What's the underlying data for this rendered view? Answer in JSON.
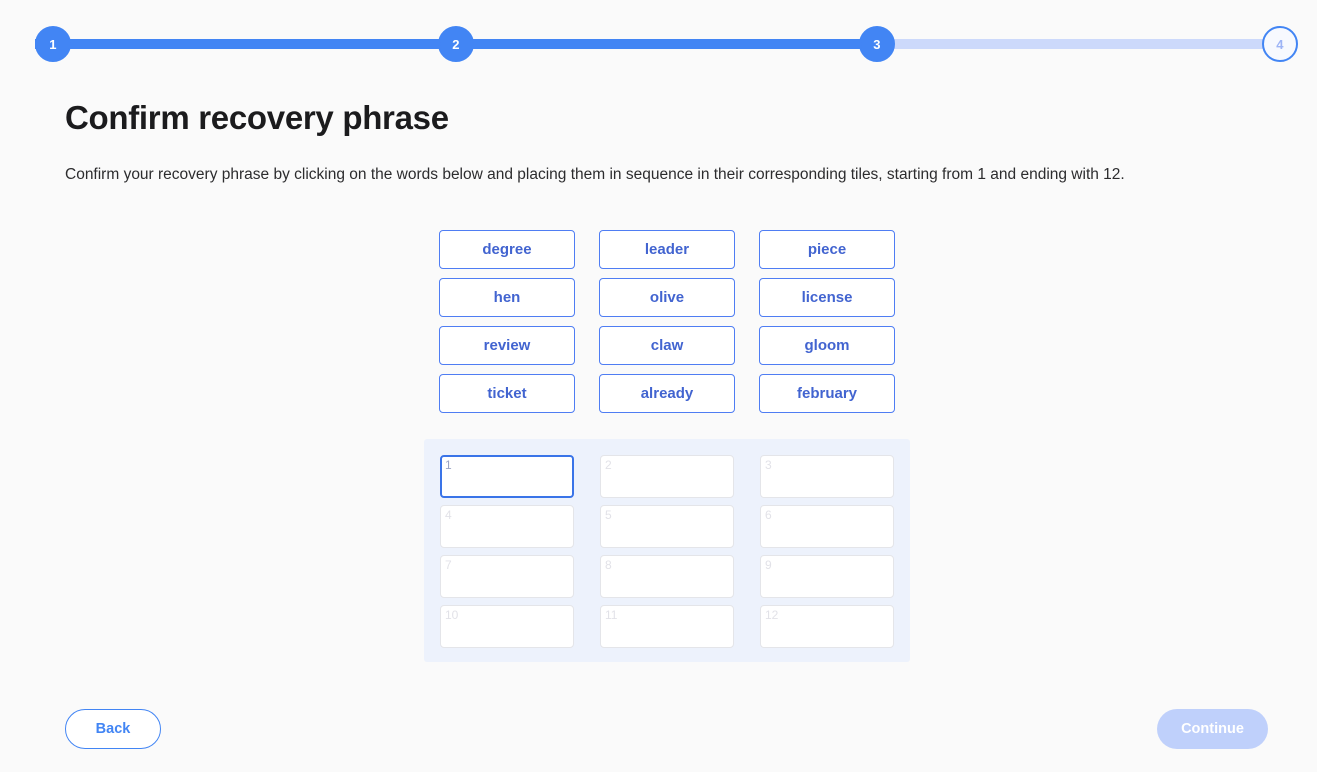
{
  "stepper": {
    "steps": [
      {
        "number": "1",
        "state": "done"
      },
      {
        "number": "2",
        "state": "done"
      },
      {
        "number": "3",
        "state": "done"
      },
      {
        "number": "4",
        "state": "todo"
      }
    ],
    "active_color": "#4285f4",
    "inactive_color": "#ccd9fb"
  },
  "page": {
    "title": "Confirm recovery phrase",
    "description": "Confirm your recovery phrase by clicking on the words below and placing them in sequence in their corresponding tiles, starting from 1 and ending with 12."
  },
  "word_bank": {
    "words": [
      "degree",
      "leader",
      "piece",
      "hen",
      "olive",
      "license",
      "review",
      "claw",
      "gloom",
      "ticket",
      "already",
      "february"
    ],
    "text_color": "#4264d0",
    "border_color": "#4f7df3"
  },
  "slots": {
    "panel_color": "#edf2fc",
    "active_index": 1,
    "items": [
      {
        "number": "1",
        "value": ""
      },
      {
        "number": "2",
        "value": ""
      },
      {
        "number": "3",
        "value": ""
      },
      {
        "number": "4",
        "value": ""
      },
      {
        "number": "5",
        "value": ""
      },
      {
        "number": "6",
        "value": ""
      },
      {
        "number": "7",
        "value": ""
      },
      {
        "number": "8",
        "value": ""
      },
      {
        "number": "9",
        "value": ""
      },
      {
        "number": "10",
        "value": ""
      },
      {
        "number": "11",
        "value": ""
      },
      {
        "number": "12",
        "value": ""
      }
    ]
  },
  "footer": {
    "back_label": "Back",
    "continue_label": "Continue",
    "continue_disabled": true
  }
}
